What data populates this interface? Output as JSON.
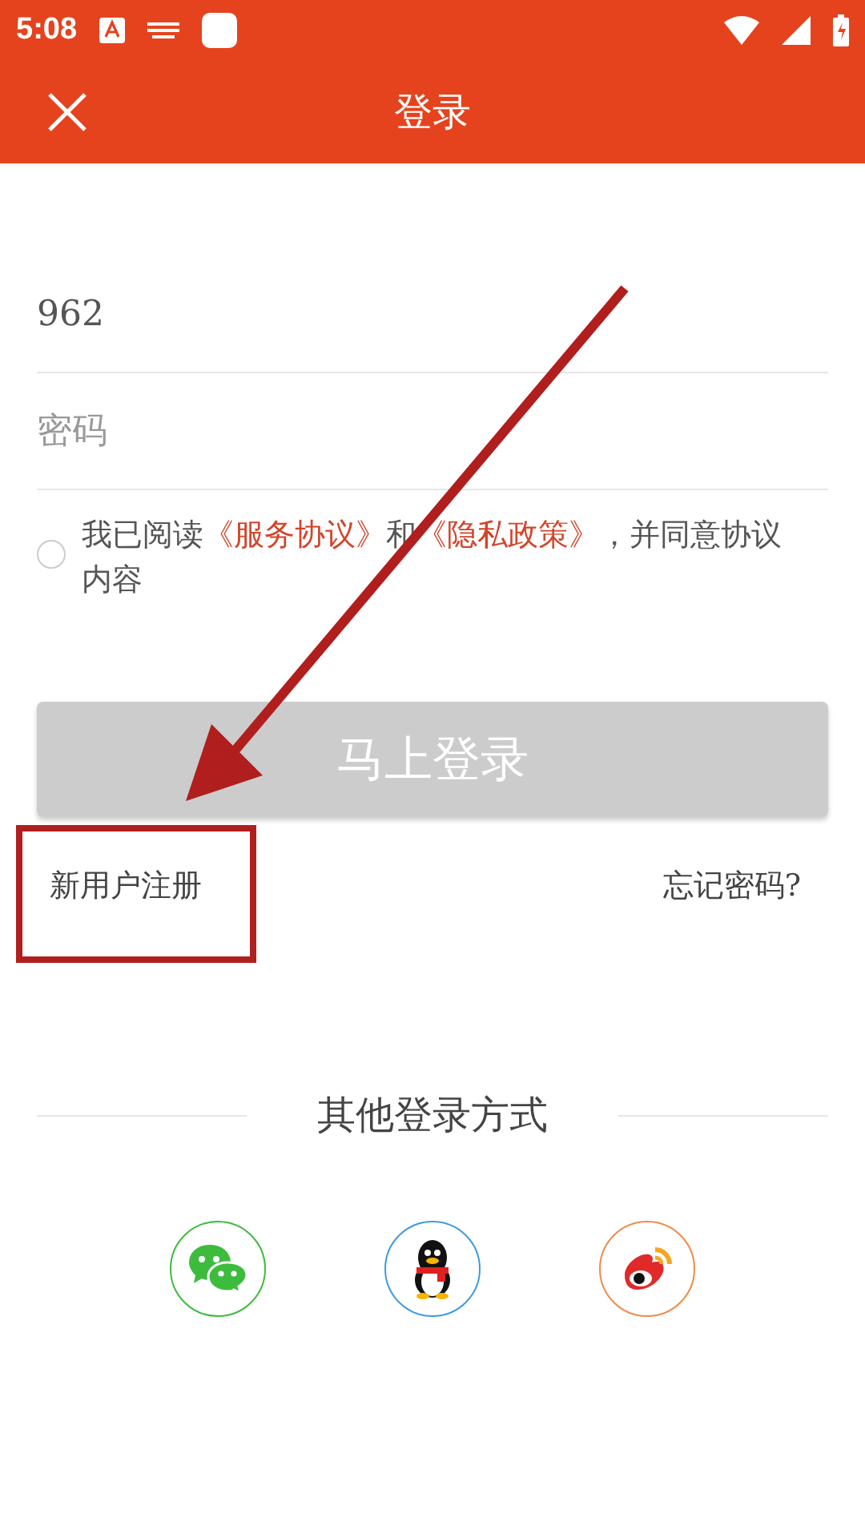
{
  "status_bar": {
    "time": "5:08"
  },
  "app_bar": {
    "title": "登录"
  },
  "form": {
    "account": {
      "value": "962"
    },
    "password": {
      "placeholder": "密码"
    },
    "agreement": {
      "checked": false,
      "parts": [
        {
          "kind": "plain",
          "text": "我已阅读"
        },
        {
          "kind": "link",
          "text": "《服务协议》"
        },
        {
          "kind": "plain",
          "text": "和"
        },
        {
          "kind": "link",
          "text": "《隐私政策》"
        },
        {
          "kind": "plain",
          "text": "，并同意协议内容"
        }
      ]
    },
    "login_button": {
      "label": "马上登录",
      "disabled": true
    }
  },
  "links": {
    "register": "新用户注册",
    "forgot": "忘记密码?"
  },
  "other_login": {
    "title": "其他登录方式",
    "methods": [
      {
        "kind": "chat",
        "color": "#3dbb3d"
      },
      {
        "kind": "penguin",
        "color": "#3d9be0"
      },
      {
        "kind": "swirl",
        "color": "#ef8a4a"
      }
    ]
  }
}
